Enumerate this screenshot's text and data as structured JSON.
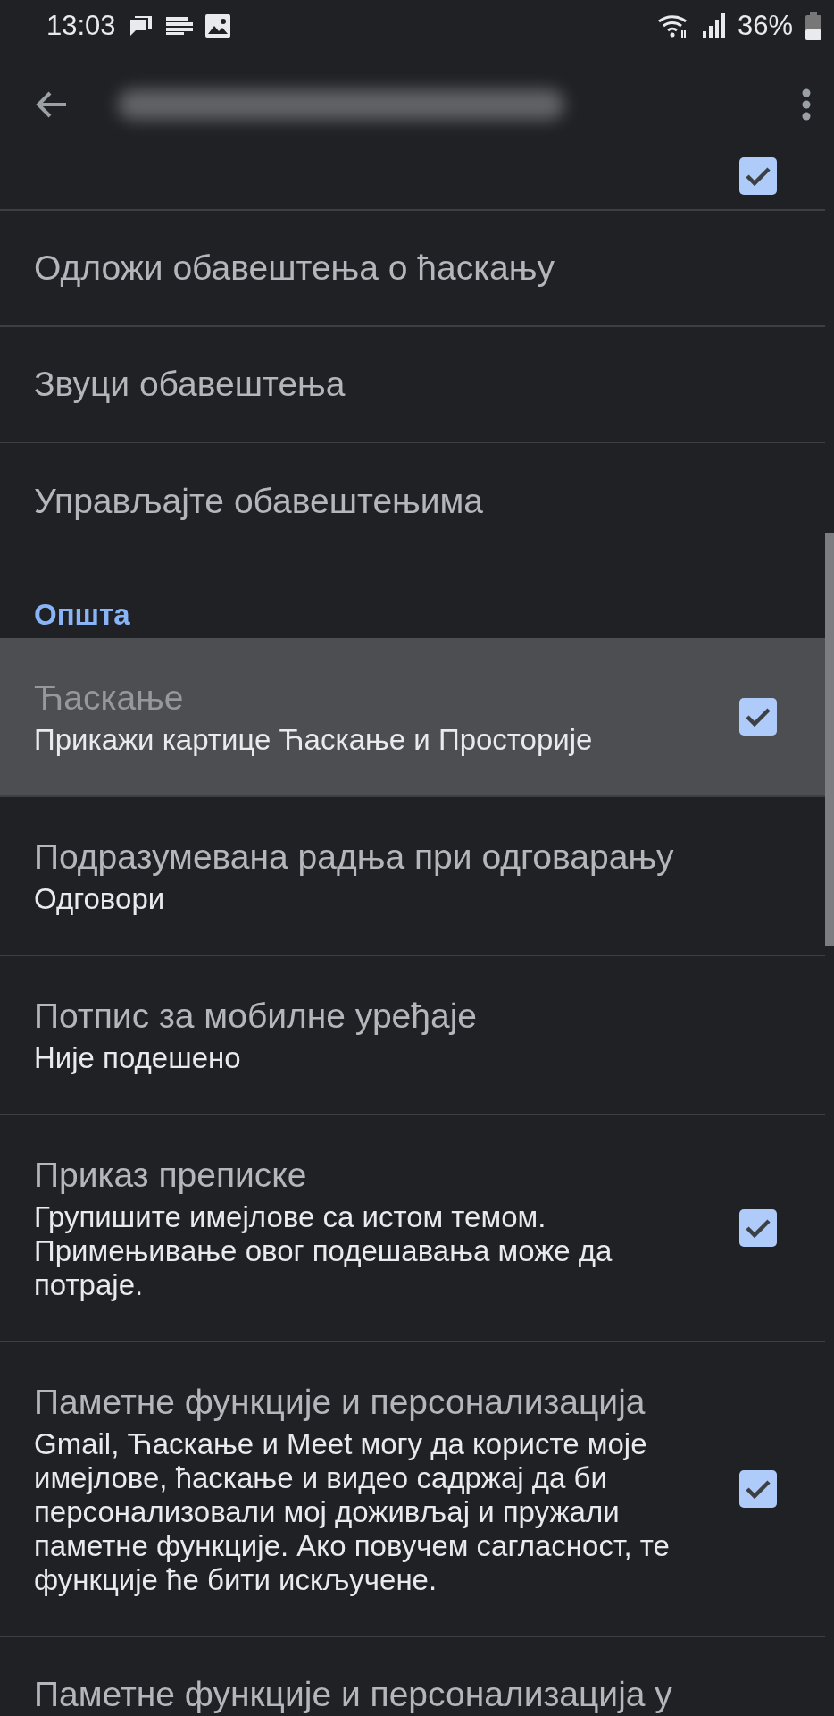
{
  "status_bar": {
    "time": "13:03",
    "battery": "36%"
  },
  "app_bar": {
    "title_blurred": true
  },
  "rows": [
    {
      "kind": "checkbox",
      "checked": true,
      "selected": false
    },
    {
      "kind": "plain",
      "title": "Одложи обавештења о ћаскању",
      "selected": false
    },
    {
      "kind": "plain",
      "title": "Звуци обавештења",
      "selected": false
    },
    {
      "kind": "plain",
      "title": "Управљајте обавештењима",
      "selected": false
    },
    {
      "kind": "header",
      "title": "Општа"
    },
    {
      "kind": "checkbox",
      "title": "Ћаскање",
      "summary": "Прикажи картице Ћаскање и Просторије",
      "checked": true,
      "selected": true
    },
    {
      "kind": "plain",
      "title": "Подразумевана радња при одговарању",
      "summary": "Одговори",
      "selected": false
    },
    {
      "kind": "plain",
      "title": "Потпис за мобилне уређаје",
      "summary": "Није подешено",
      "selected": false
    },
    {
      "kind": "checkbox",
      "title": "Приказ преписке",
      "summary": "Групишите имејлове са истом темом. Примењивање овог подешавања може да потраје.",
      "checked": true,
      "selected": false
    },
    {
      "kind": "checkbox",
      "title": "Паметне функције и персонализација",
      "summary": "Gmail, Ћаскање и Meet могу да користе моје имејлове, ћаскање и видео садржај да би персонализовали мој доживљај и пружали паметне функције. Ако повучем сагласност, те функције ће бити искључене.",
      "checked": true,
      "selected": false
    },
    {
      "kind": "plain",
      "title": "Паметне функције и персонализација у",
      "selected": false
    }
  ]
}
